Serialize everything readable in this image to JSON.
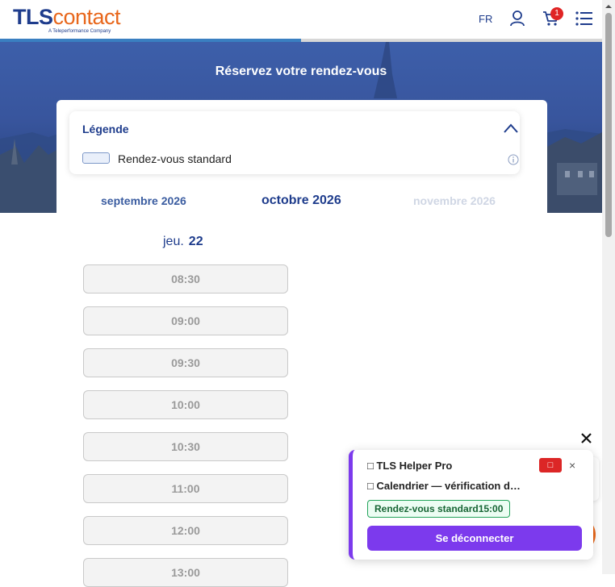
{
  "header": {
    "logo_tls": "TLS",
    "logo_contact": "contact",
    "logo_tagline": "A Teleperformance Company",
    "language": "FR",
    "cart_count": "1",
    "icons": [
      "user-icon",
      "cart-icon",
      "menu-icon"
    ]
  },
  "progress": {
    "fraction": 0.5
  },
  "hero": {
    "title": "Réservez votre rendez-vous"
  },
  "legend": {
    "title": "Légende",
    "item_label": "Rendez-vous standard"
  },
  "months": {
    "previous": "septembre 2026",
    "current": "octobre 2026",
    "next": "novembre 2026"
  },
  "day": {
    "weekday": "jeu.",
    "number": "22"
  },
  "slots": [
    "08:30",
    "09:00",
    "09:30",
    "10:00",
    "10:30",
    "11:00",
    "12:00",
    "13:00"
  ],
  "helper": {
    "title": "□ TLS Helper Pro",
    "status": "□ Calendrier — vérification des créneaux",
    "stop_label": "□",
    "close_label": "×",
    "tag": "Rendez-vous standard15:00",
    "logout_label": "Se déconnecter"
  },
  "overlay": {
    "close_label": "×"
  },
  "colors": {
    "brand_blue": "#1e3c8c",
    "brand_orange": "#e8671c",
    "accent_purple": "#7c3aed",
    "badge_red": "#e02424"
  }
}
